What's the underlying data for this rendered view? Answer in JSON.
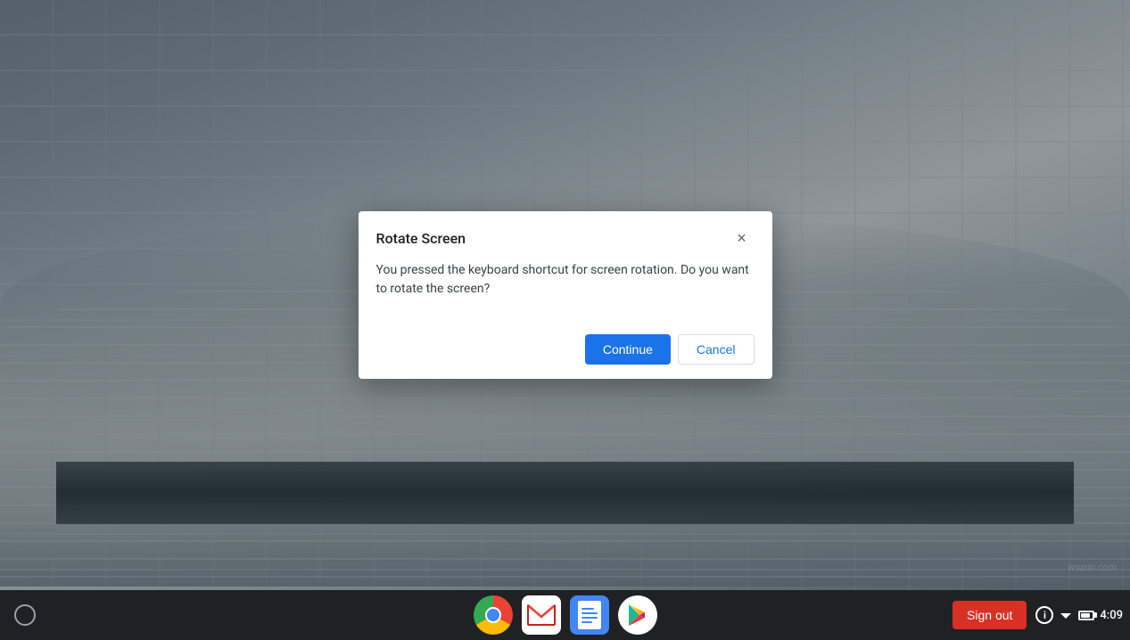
{
  "desktop": {
    "watermark": "wsxdn.com"
  },
  "dialog": {
    "title": "Rotate Screen",
    "message": "You pressed the keyboard shortcut for screen rotation. Do you want to rotate the screen?",
    "close_label": "×",
    "continue_label": "Continue",
    "cancel_label": "Cancel"
  },
  "taskbar": {
    "launcher_label": "",
    "sign_out_label": "Sign out",
    "time": "4:09",
    "dock_icons": [
      {
        "id": "chrome",
        "label": "Chrome"
      },
      {
        "id": "gmail",
        "label": "Gmail"
      },
      {
        "id": "docs",
        "label": "Google Docs"
      },
      {
        "id": "play",
        "label": "Play Store"
      }
    ]
  },
  "icons": {
    "launcher": "○",
    "close": "×",
    "wifi": "wifi",
    "battery": "battery",
    "info": "i"
  }
}
